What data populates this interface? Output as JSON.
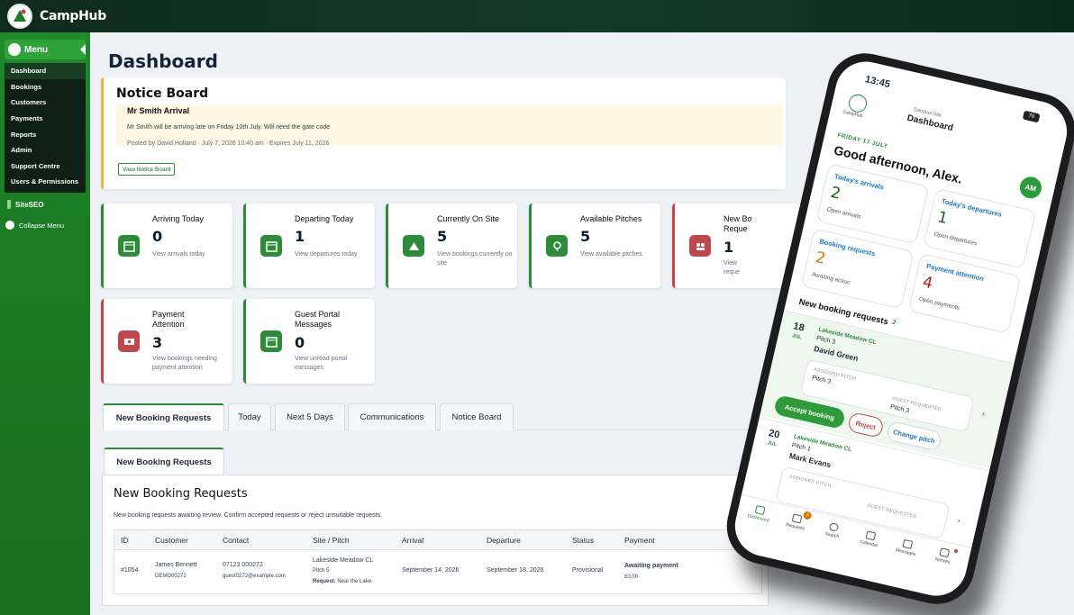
{
  "app": {
    "brand": "CampHub"
  },
  "sidebar": {
    "menu_label": "Menu",
    "items": [
      {
        "label": "Dashboard"
      },
      {
        "label": "Bookings"
      },
      {
        "label": "Customers"
      },
      {
        "label": "Payments"
      },
      {
        "label": "Reports"
      },
      {
        "label": "Admin"
      },
      {
        "label": "Support Centre"
      },
      {
        "label": "Users & Permissions"
      }
    ],
    "siteseo_label": "SiteSEO",
    "collapse_label": "Collapse Menu"
  },
  "page": {
    "title": "Dashboard"
  },
  "notice_board": {
    "title": "Notice Board",
    "notice_title": "Mr Smith Arrival",
    "notice_message": "Mr Smith will be arriving late on Friday 10th July. Will need the gate code",
    "notice_meta": "Posted by David Holland · July 7, 2026 10:40 am · Expires July 11, 2026",
    "view_button": "View Notice Board"
  },
  "stats": [
    {
      "title": "Arriving Today",
      "value": "0",
      "sub": "View arrivals today",
      "icon": "calendar-icon",
      "status": "green"
    },
    {
      "title": "Departing Today",
      "value": "1",
      "sub": "View departures today",
      "icon": "calendar-icon",
      "status": "green"
    },
    {
      "title": "Currently On Site",
      "value": "5",
      "sub": "View bookings currently on site",
      "icon": "tent-icon",
      "status": "green"
    },
    {
      "title": "Available Pitches",
      "value": "5",
      "sub": "View available pitches",
      "icon": "map-pin-icon",
      "status": "green"
    },
    {
      "title": "New Bo",
      "title2": "Reque",
      "value": "1",
      "sub": "View",
      "sub2": "reque",
      "icon": "users-icon",
      "status": "red"
    },
    {
      "title": "Payment",
      "title2": "Attention",
      "value": "3",
      "sub": "View bookings needing",
      "sub2": "payment attention",
      "icon": "cash-icon",
      "status": "red"
    },
    {
      "title": "Guest Portal",
      "title2": "Messages",
      "value": "0",
      "sub": "View unread portal",
      "sub2": "messages",
      "icon": "calendar-icon",
      "status": "green"
    }
  ],
  "tabs": [
    "New Booking Requests",
    "Today",
    "Next 5 Days",
    "Communications",
    "Notice Board"
  ],
  "sub_tab": "New Booking Requests",
  "requests_panel": {
    "title": "New Booking Requests",
    "description": "New booking requests awaiting review. Confirm accepted requests or reject unsuitable requests.",
    "columns": [
      "ID",
      "Customer",
      "Contact",
      "Site / Pitch",
      "Arrival",
      "Departure",
      "Status",
      "Payment"
    ],
    "rows": [
      {
        "id": "#1054",
        "customer": "James Bennett",
        "customer_ref": "DEMO00272",
        "phone": "07123 000272",
        "email": "guest0272@example.com",
        "site": "Lakeside Meadow CL",
        "pitch": "Pitch 5",
        "request_label": "Request:",
        "request": "Near the Lake",
        "arrival": "September 14, 2026",
        "departure": "September 18, 2026",
        "status": "Provisional",
        "payment": "Awaiting payment",
        "amount": "£0.00"
      }
    ]
  },
  "phone": {
    "time": "13:45",
    "battery": "70",
    "logo_text": "CampHub",
    "site_label": "Campus Site",
    "title": "Dashboard",
    "date": "FRIDAY 17 JULY",
    "greeting": "Good afternoon, Alex.",
    "avatar": "AM",
    "tiles": [
      {
        "label": "Today's arrivals",
        "value": "2",
        "sub": "Open arrivals",
        "color": "#1a5e2a"
      },
      {
        "label": "Today's departures",
        "value": "1",
        "sub": "Open departures",
        "color": "#1a5e2a"
      },
      {
        "label": "Booking requests",
        "value": "2",
        "sub": "Awaiting action",
        "color": "#d97706"
      },
      {
        "label": "Payment attention",
        "value": "4",
        "sub": "Open payments",
        "color": "#b91c1c"
      }
    ],
    "section_title": "New booking requests",
    "section_count": "2",
    "requests": [
      {
        "day": "18",
        "month": "JUL",
        "site": "Lakeside Meadow CL",
        "pitch": "Pitch 3",
        "name": "David Green",
        "assigned_label": "ASSIGNED PITCH",
        "assigned": "Pitch 3",
        "guest_label": "GUEST REQUESTED",
        "guest": "Pitch 3"
      },
      {
        "day": "20",
        "month": "JUL",
        "site": "Lakeside Meadow CL",
        "pitch": "Pitch 1",
        "name": "Mark Evans",
        "assigned_label": "ASSIGNED PITCH",
        "guest_label": "GUEST REQUESTED"
      }
    ],
    "accept": "Accept booking",
    "reject": "Reject",
    "change": "Change pitch",
    "nav": [
      "Dashboard",
      "Requests",
      "Search",
      "Calendar",
      "Messages",
      "Notices"
    ],
    "nav_badge": "2"
  }
}
